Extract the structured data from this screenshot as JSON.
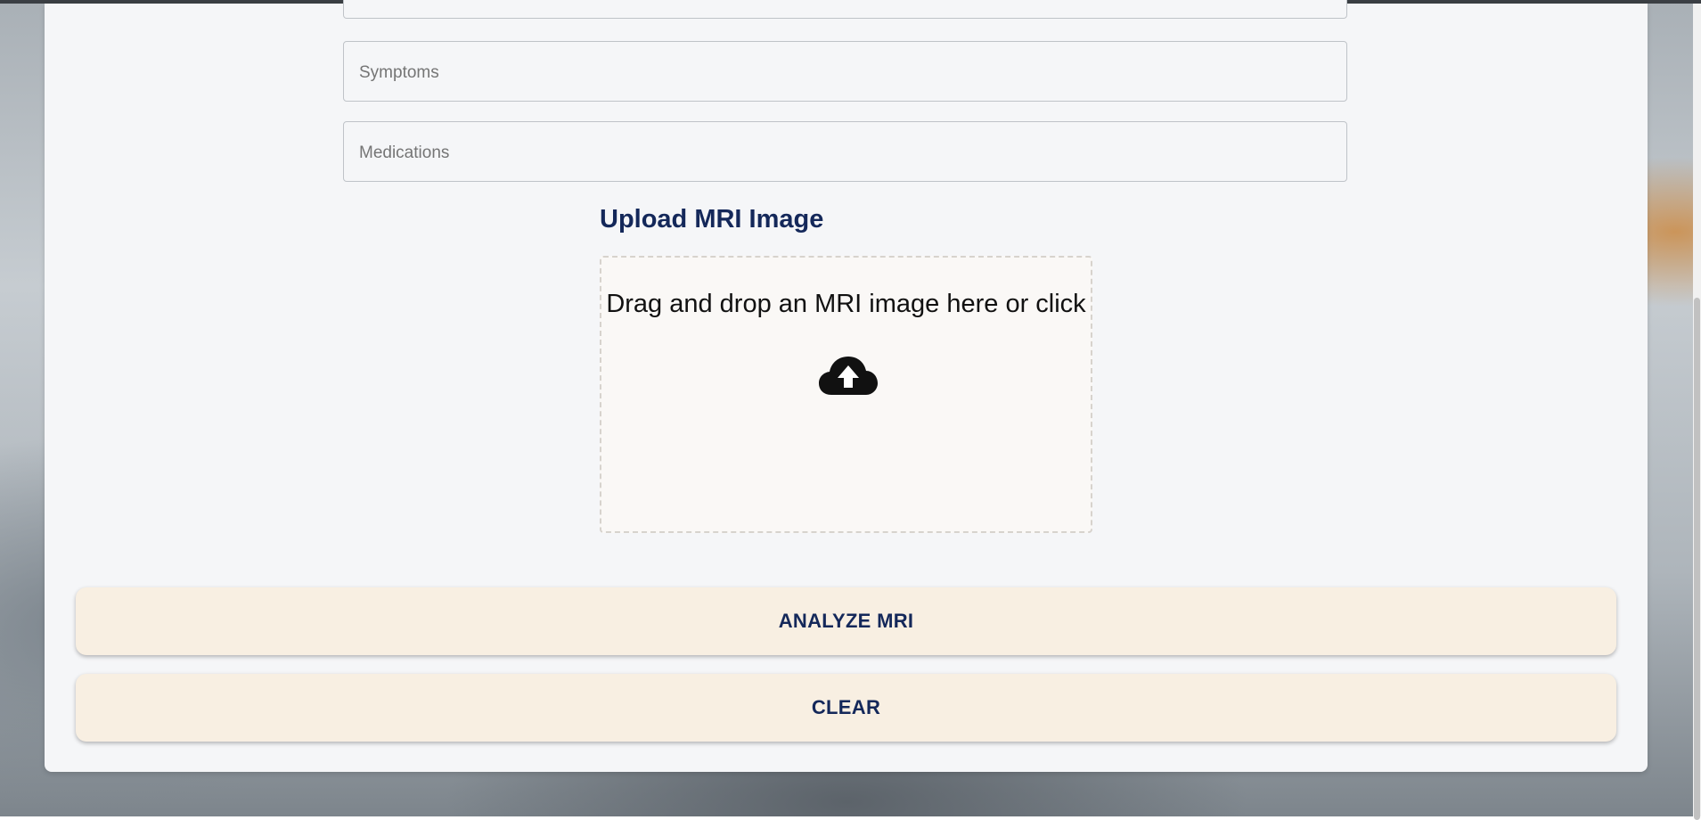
{
  "form": {
    "symptoms_placeholder": "Symptoms",
    "medications_placeholder": "Medications"
  },
  "upload": {
    "title": "Upload MRI Image",
    "dropzone_text": "Drag and drop an MRI image here or click",
    "icon": "cloud-upload-icon"
  },
  "actions": {
    "analyze_label": "ANALYZE MRI",
    "clear_label": "CLEAR"
  },
  "colors": {
    "heading": "#14285a",
    "button_bg": "#f8efe2",
    "card_bg": "#f5f6f8"
  }
}
